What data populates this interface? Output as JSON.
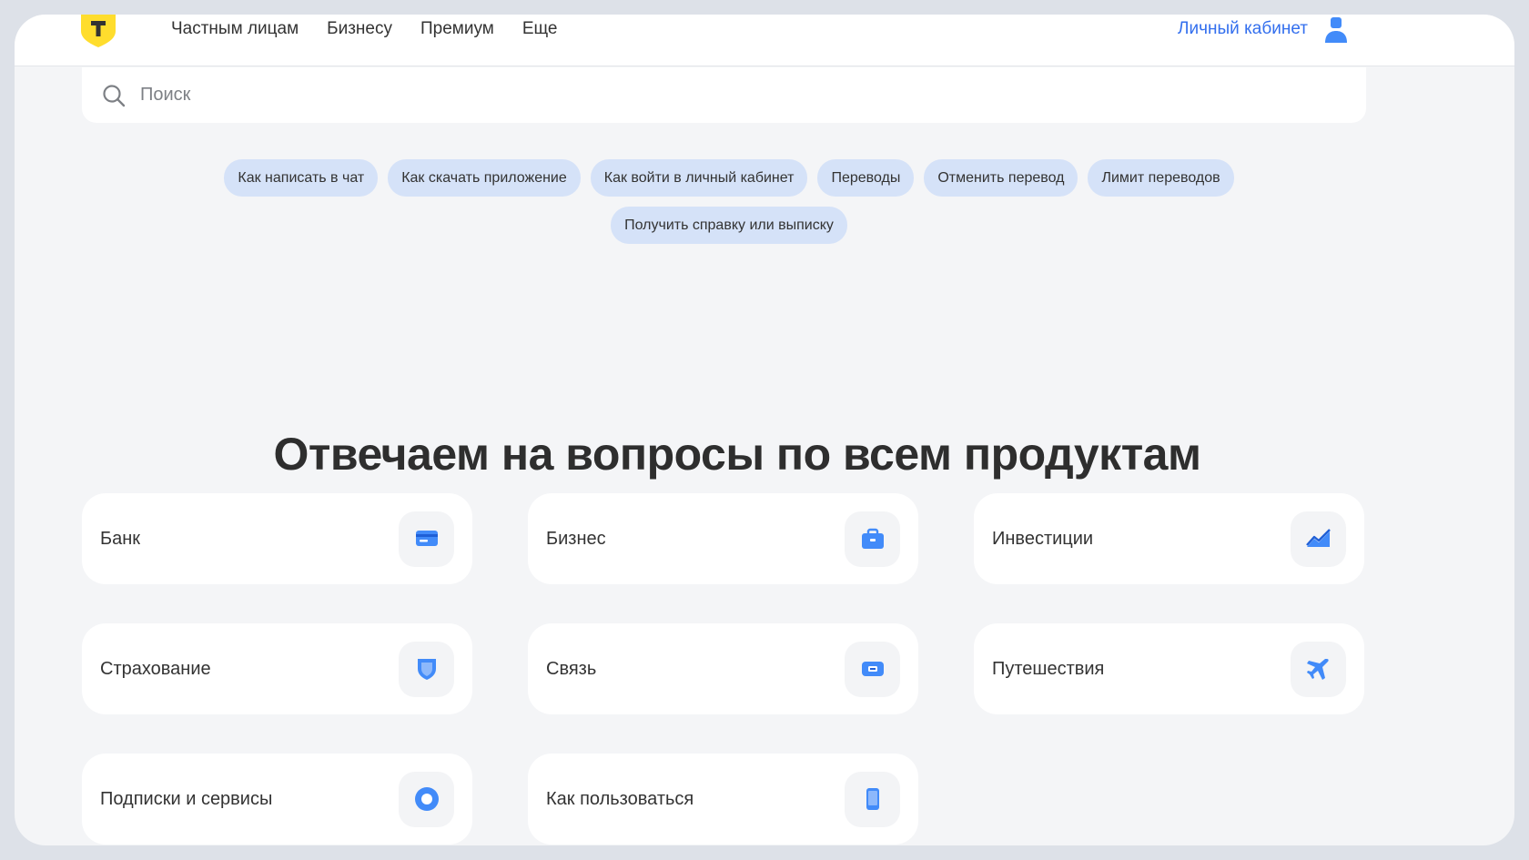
{
  "header": {
    "nav": [
      "Частным лицам",
      "Бизнесу",
      "Премиум",
      "Еще"
    ],
    "account_label": "Личный кабинет"
  },
  "search": {
    "placeholder": "Поиск"
  },
  "chips": [
    "Как написать в чат",
    "Как скачать приложение",
    "Как войти в личный кабинет",
    "Переводы",
    "Отменить перевод",
    "Лимит переводов",
    "Получить справку или выписку"
  ],
  "heading": "Отвечаем на вопросы по всем продуктам",
  "products": [
    {
      "label": "Банк",
      "icon": "card-icon"
    },
    {
      "label": "Бизнес",
      "icon": "briefcase-icon"
    },
    {
      "label": "Инвестиции",
      "icon": "chart-icon"
    },
    {
      "label": "Страхование",
      "icon": "shield-icon"
    },
    {
      "label": "Связь",
      "icon": "sim-icon"
    },
    {
      "label": "Путешествия",
      "icon": "plane-icon"
    },
    {
      "label": "Подписки и сервисы",
      "icon": "circle-icon"
    },
    {
      "label": "Как пользоваться",
      "icon": "phone-icon"
    }
  ],
  "colors": {
    "accent": "#336fee",
    "icon_blue": "#428bf9",
    "chip_bg": "#d5e2f8",
    "logo_yellow": "#ffdd2d"
  }
}
